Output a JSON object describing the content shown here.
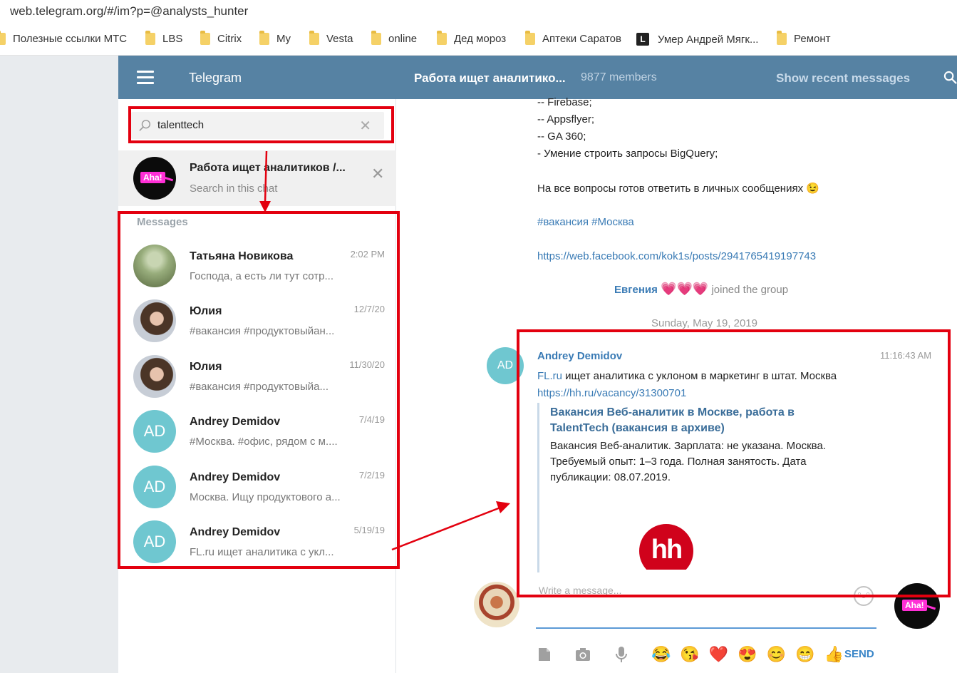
{
  "browser": {
    "url": "web.telegram.org/#/im?p=@analysts_hunter",
    "bookmarks": [
      "Полезные ссылки МТС",
      "LBS",
      "Citrix",
      "My",
      "Vesta",
      "online",
      "Дед мороз",
      "Аптеки Саратов",
      "Умер Андрей Мягк...",
      "Ремонт"
    ]
  },
  "header": {
    "app_title": "Telegram",
    "chat_title": "Работа ищет аналитико...",
    "members": "9877 members",
    "recent_button": "Show recent messages"
  },
  "search": {
    "value": "talenttech",
    "chat_result": {
      "name": "Работа ищет аналитиков /...",
      "sub": "Search in this chat",
      "avatar_text": "Aha!"
    },
    "section_label": "Messages",
    "results": [
      {
        "name": "Татьяна Новикова",
        "date": "2:02 PM",
        "preview": "Господа, а есть ли тут сотр..."
      },
      {
        "name": "Юлия",
        "date": "12/7/20",
        "preview": "#вакансия #продуктовыйан..."
      },
      {
        "name": "Юлия",
        "date": "11/30/20",
        "preview": "#вакансия #продуктовыйа..."
      },
      {
        "name": "Andrey Demidov",
        "date": "7/4/19",
        "preview": "#Москва. #офис, рядом с м....",
        "avatar": "AD"
      },
      {
        "name": "Andrey Demidov",
        "date": "7/2/19",
        "preview": "Москва. Ищу продуктового а...",
        "avatar": "AD"
      },
      {
        "name": "Andrey Demidov",
        "date": "5/19/19",
        "preview": "FL.ru ищет аналитика с укл...",
        "avatar": "AD"
      }
    ]
  },
  "chat": {
    "lines": [
      "-- Firebase;",
      "-- Appsflyer;",
      "-- GA 360;",
      "- Умение строить запросы BigQuery;",
      "На все вопросы готов ответить в личных сообщениях 😉",
      "#вакансия #Москва",
      "https://web.facebook.com/kok1s/posts/2941765419197743"
    ],
    "joined_name": "Евгения",
    "joined_hearts": "💗💗💗",
    "joined_text": "joined the group",
    "date_separator": "Sunday, May 19, 2019",
    "message": {
      "avatar": "AD",
      "author": "Andrey Demidov",
      "time": "11:16:43 AM",
      "link1": "FL.ru",
      "text": " ищет аналитика с уклоном в маркетинг в штат. Москва",
      "link2": "https://hh.ru/vacancy/31300701",
      "preview_title": "Вакансия Веб-аналитик в Москве, работа в TalentTech (вакансия в архиве)",
      "preview_desc": "Вакансия Веб-аналитик. Зарплата: не указана. Москва. Требуемый опыт: 1–3 года. Полная занятость. Дата публикации: 08.07.2019.",
      "preview_logo": "hh"
    },
    "compose_placeholder": "Write a message...",
    "send_label": "SEND",
    "emojis": [
      "😂",
      "😘",
      "❤️",
      "😍",
      "😊",
      "😁",
      "👍"
    ]
  },
  "colors": {
    "header_bg": "#5682a3",
    "annotation": "#e3000f",
    "link": "#3a7bb5"
  }
}
